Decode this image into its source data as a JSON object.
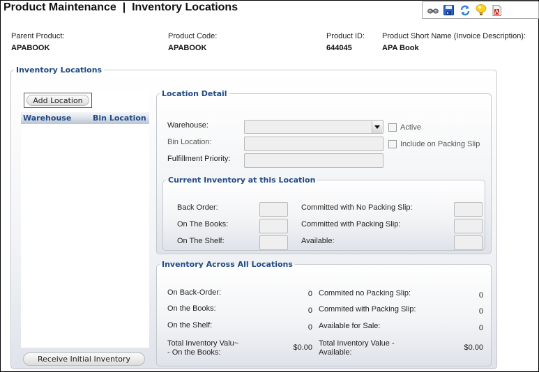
{
  "header": {
    "title": "Product Maintenance  |  Inventory Locations",
    "toolbar_icons": [
      "binoculars-icon",
      "save-icon",
      "refresh-icon",
      "lightbulb-icon",
      "report-icon"
    ]
  },
  "product": {
    "parent_product_label": "Parent Product:",
    "parent_product_value": "APABOOK",
    "product_code_label": "Product Code:",
    "product_code_value": "APABOOK",
    "product_id_label": "Product ID:",
    "product_id_value": "644045",
    "short_name_label": "Product Short Name (Invoice Description):",
    "short_name_value": "APA Book"
  },
  "inventory_locations": {
    "legend": "Inventory Locations",
    "add_location_label": "Add Location",
    "grid_columns": [
      "Warehouse",
      "Bin Location"
    ],
    "rows": [],
    "receive_initial_inventory_label": "Receive Initial Inventory"
  },
  "location_detail": {
    "legend": "Location Detail",
    "warehouse_label": "Warehouse:",
    "warehouse_value": "",
    "bin_location_label": "Bin Location:",
    "bin_location_value": "",
    "fulfillment_priority_label": "Fulfillment Priority:",
    "fulfillment_priority_value": "",
    "active_label": "Active",
    "active_checked": false,
    "include_packing_slip_label": "Include on Packing Slip",
    "include_packing_slip_checked": false
  },
  "current_inventory": {
    "legend": "Current Inventory at this Location",
    "back_order_label": "Back Order:",
    "on_the_books_label": "On The Books:",
    "on_the_shelf_label": "On The Shelf:",
    "committed_no_slip_label": "Committed with No Packing Slip:",
    "committed_slip_label": "Committed with Packing Slip:",
    "available_label": "Available:"
  },
  "all_inventory": {
    "legend": "Inventory Across All Locations",
    "on_back_order_label": "On Back-Order:",
    "on_back_order_value": "0",
    "on_the_books_label": "On the Books:",
    "on_the_books_value": "0",
    "on_the_shelf_label": "On the Shelf:",
    "on_the_shelf_value": "0",
    "total_value_books_label_1": "Total Inventory Valu~",
    "total_value_books_label_2": "- On the Books:",
    "total_value_books_value": "$0.00",
    "committed_no_slip_label": "Commited no Packing Slip:",
    "committed_no_slip_value": "0",
    "committed_slip_label": "Commited with Packing Slip:",
    "committed_slip_value": "0",
    "available_for_sale_label": "Available for Sale:",
    "available_for_sale_value": "0",
    "total_value_available_label_1": "Total Inventory Value -",
    "total_value_available_label_2": "Available:",
    "total_value_available_value": "$0.00"
  }
}
